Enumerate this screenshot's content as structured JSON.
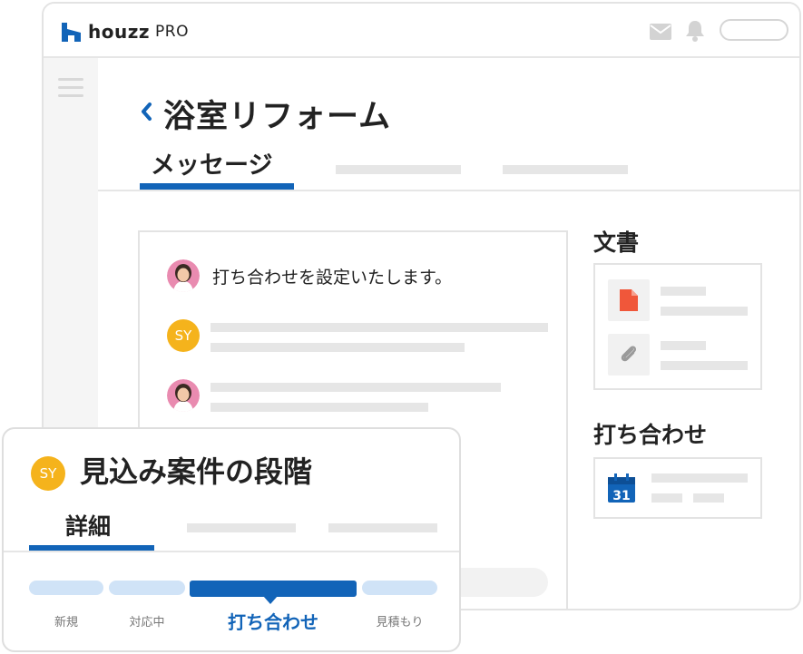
{
  "app": {
    "logo": "houzz",
    "logo_suffix": "PRO"
  },
  "header_icons": [
    "mail-icon",
    "bell-icon"
  ],
  "page": {
    "title": "浴室リフォーム",
    "active_tab": "メッセージ"
  },
  "messages": [
    {
      "avatar": "woman-photo",
      "text": "打ち合わせを設定いたします。"
    },
    {
      "avatar_initials": "SY",
      "text": ""
    },
    {
      "avatar": "woman-photo",
      "text": ""
    }
  ],
  "documents": {
    "heading": "文書",
    "icons": [
      "pdf-file-icon",
      "paperclip-icon"
    ]
  },
  "meeting": {
    "heading": "打ち合わせ",
    "calendar_day": "31"
  },
  "lead_stage": {
    "avatar_initials": "SY",
    "title": "見込み案件の段階",
    "active_tab": "詳細",
    "stages": [
      {
        "label": "新規",
        "active": false
      },
      {
        "label": "対応中",
        "active": false
      },
      {
        "label": "打ち合わせ",
        "active": true
      },
      {
        "label": "見積もり",
        "active": false
      }
    ]
  },
  "colors": {
    "accent": "#1264b8",
    "avatar_yellow": "#f5b31c",
    "pdf_red": "#f0573a",
    "stage_inactive": "#d0e3f7"
  }
}
